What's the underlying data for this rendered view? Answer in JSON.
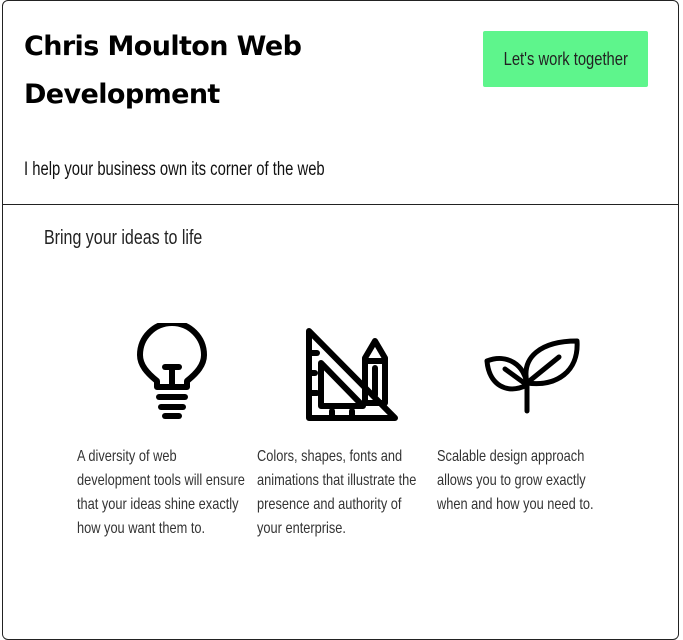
{
  "header": {
    "title": "Chris Moulton Web Development",
    "cta_label": "Let's work together",
    "tagline": "I help your business own its corner of the web"
  },
  "colors": {
    "cta_background": "#5ef58c",
    "text": "#000000",
    "border": "#222222"
  },
  "main": {
    "heading": "Bring your ideas to life",
    "features": [
      {
        "icon": "lightbulb-icon",
        "text": "A diversity of web development tools will ensure that your ideas shine exactly how you want them to."
      },
      {
        "icon": "ruler-pencil-icon",
        "text": "Colors, shapes, fonts and animations that illustrate the presence and authority of your enterprise."
      },
      {
        "icon": "sprout-icon",
        "text": "Scalable design approach allows you to grow exactly when and how you need to."
      }
    ]
  }
}
